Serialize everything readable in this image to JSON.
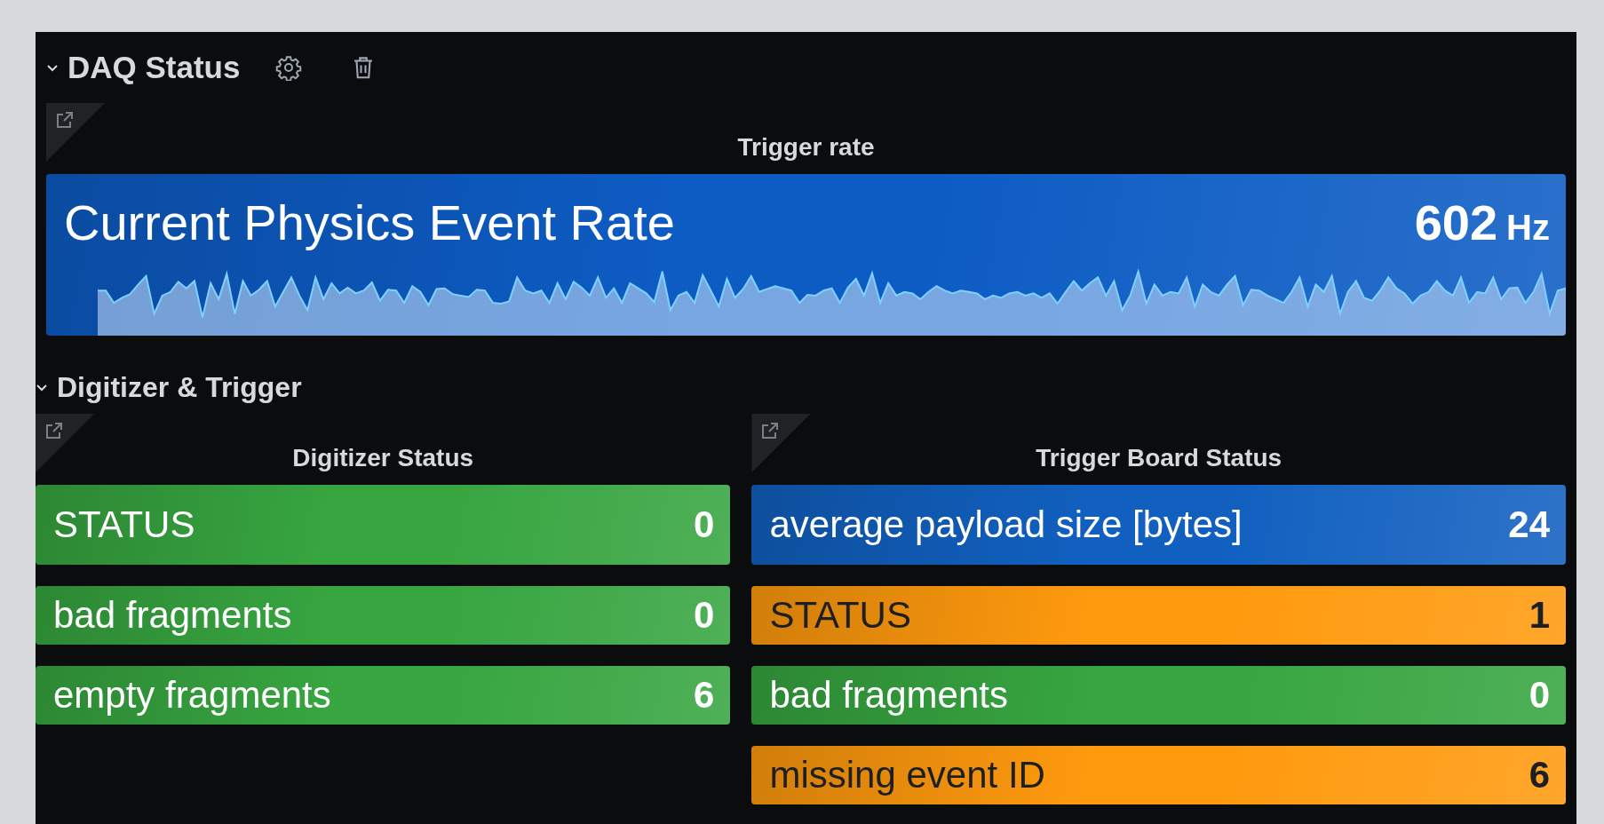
{
  "rows": [
    {
      "title": "DAQ Status",
      "expanded": true,
      "show_actions": true,
      "panels": [
        {
          "title": "Trigger rate",
          "tiles": [
            {
              "label": "Current Physics Event Rate",
              "value": "602",
              "unit": "Hz",
              "color": "#0d5cc4",
              "kind": "sparkline"
            }
          ]
        }
      ]
    },
    {
      "title": "Digitizer & Trigger",
      "expanded": true,
      "panels": [
        {
          "title": "Digitizer Status",
          "tiles": [
            {
              "label": "STATUS",
              "value": "0",
              "color": "#37a540"
            },
            {
              "label": "bad fragments",
              "value": "0",
              "color": "#37a540"
            },
            {
              "label": "empty fragments",
              "value": "6",
              "color": "#37a540"
            }
          ]
        },
        {
          "title": "Trigger Board Status",
          "tiles": [
            {
              "label": "average payload size [bytes]",
              "value": "24",
              "color": "#1160c0"
            },
            {
              "label": "STATUS",
              "value": "1",
              "color": "#ff9a0e"
            },
            {
              "label": "bad fragments",
              "value": "0",
              "color": "#37a540"
            },
            {
              "label": "missing event ID",
              "value": "6",
              "color": "#ff9a0e"
            }
          ]
        }
      ]
    }
  ]
}
